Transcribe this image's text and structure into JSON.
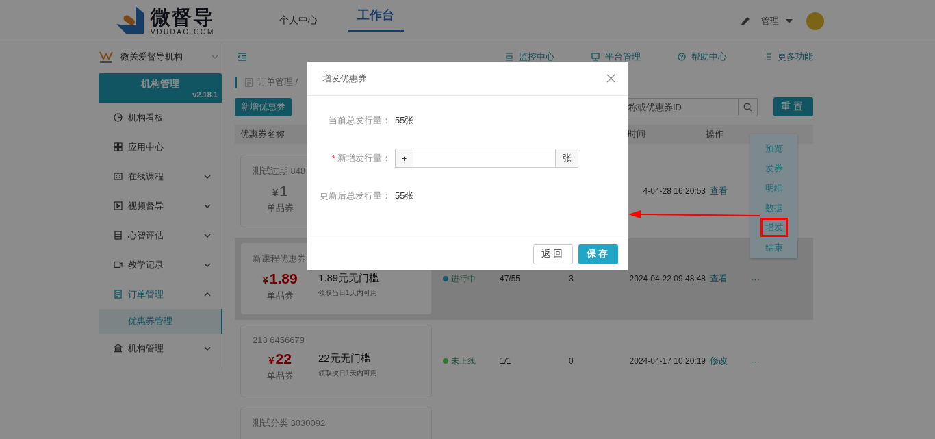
{
  "header": {
    "brand": "微督导",
    "domain": "VDUDAO.COM",
    "nav": [
      {
        "label": "个人中心",
        "selected": false
      },
      {
        "label": "工作台",
        "selected": true
      }
    ],
    "user_menu": "管理"
  },
  "org": {
    "name": "微关爱督导机构"
  },
  "top_links": [
    {
      "label": "监控中心"
    },
    {
      "label": "平台管理"
    },
    {
      "label": "帮助中心"
    },
    {
      "label": "更多功能"
    }
  ],
  "sidebar": {
    "title": "机构管理",
    "version": "v2.18.1",
    "items": [
      {
        "label": "机构看板",
        "kind": "link",
        "selected": false
      },
      {
        "label": "应用中心",
        "kind": "link",
        "selected": false
      },
      {
        "label": "在线课程",
        "kind": "group",
        "expanded": false,
        "selected": false
      },
      {
        "label": "视频督导",
        "kind": "group",
        "expanded": false,
        "selected": false
      },
      {
        "label": "心智评估",
        "kind": "group",
        "expanded": false,
        "selected": false
      },
      {
        "label": "教学记录",
        "kind": "group",
        "expanded": false,
        "selected": false
      },
      {
        "label": "订单管理",
        "kind": "group",
        "expanded": true,
        "selected": true,
        "children": [
          {
            "label": "优惠券管理",
            "selected": true
          }
        ]
      },
      {
        "label": "机构管理",
        "kind": "group",
        "expanded": false,
        "selected": false
      }
    ]
  },
  "main": {
    "breadcrumb": "订单管理 /",
    "add_button": "新增优惠券",
    "search": {
      "placeholder": "称或优惠券ID"
    },
    "reset_button": "重置",
    "table": {
      "columns": {
        "name": "优惠券名称",
        "time": "时间",
        "actions": "操作"
      },
      "rows": [
        {
          "name": "测试过期 848",
          "currency": "¥",
          "amount": "1",
          "type": "单品券",
          "expired": true,
          "hovered": false,
          "time": "4-04-28 16:20:53",
          "action": "查看"
        },
        {
          "name": "新课程优惠券",
          "currency": "¥",
          "amount": "1.89",
          "type": "单品券",
          "rule": "1.89元无门槛",
          "note": "领取当日1天内可用",
          "expired": false,
          "hovered": true,
          "status": {
            "label": "进行中",
            "color": "#11596b"
          },
          "issued": "47/55",
          "used": "3",
          "time": "2024-04-22 09:48:48",
          "action": "查看",
          "more": "···"
        },
        {
          "name": "213 6456679",
          "currency": "¥",
          "amount": "22",
          "type": "单品券",
          "rule": "22元无门槛",
          "note": "领取次日1天内可用",
          "expired": false,
          "hovered": false,
          "status": {
            "label": "未上线",
            "color": "#2e7a2e"
          },
          "issued": "1/1",
          "used": "0",
          "time": "2024-04-17 10:20:19",
          "action": "修改",
          "more": "···"
        },
        {
          "name": "测试分类 3030092",
          "hovered": false
        }
      ]
    }
  },
  "popup_menu": [
    {
      "label": "预览",
      "selected": false
    },
    {
      "label": "发券",
      "selected": false
    },
    {
      "label": "明细",
      "selected": false
    },
    {
      "label": "数据",
      "selected": false
    },
    {
      "label": "增发",
      "selected": true
    },
    {
      "label": "结束",
      "selected": false
    }
  ],
  "dialog": {
    "title": "增发优惠券",
    "fields": [
      {
        "kind": "readout",
        "label": "当前总发行量：",
        "value": "55张"
      },
      {
        "kind": "input",
        "label": "新增发行量：",
        "required_mark": "*",
        "prefix": "+",
        "suffix": "张"
      },
      {
        "kind": "readout",
        "label": "更新后总发行量：",
        "value": "55张"
      }
    ],
    "buttons": [
      {
        "label": "返回",
        "kind": "default"
      },
      {
        "label": "保存",
        "kind": "primary"
      }
    ]
  }
}
